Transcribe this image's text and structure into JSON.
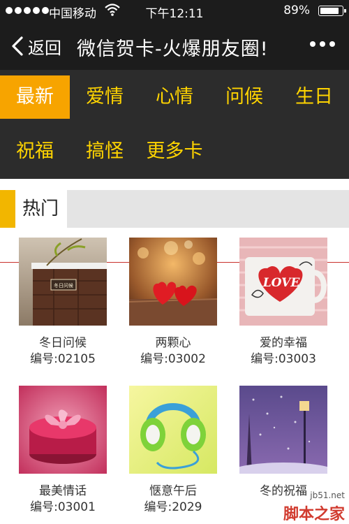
{
  "status_bar": {
    "carrier": "中国移动",
    "time": "下午12:11",
    "battery_percent": "89%",
    "battery_level": 0.89
  },
  "nav": {
    "back_label": "返回",
    "title": "微信贺卡-火爆朋友圈!"
  },
  "categories": [
    {
      "label": "最新",
      "active": true
    },
    {
      "label": "爱情",
      "active": false
    },
    {
      "label": "心情",
      "active": false
    },
    {
      "label": "问候",
      "active": false
    },
    {
      "label": "生日",
      "active": false
    },
    {
      "label": "祝福",
      "active": false
    },
    {
      "label": "搞怪",
      "active": false
    },
    {
      "label": "更多卡",
      "active": false
    }
  ],
  "section": {
    "title": "热门"
  },
  "cards": [
    {
      "name": "冬日问候",
      "code_label": "编号:",
      "code": "02105"
    },
    {
      "name": "两颗心",
      "code_label": "编号:",
      "code": "03002"
    },
    {
      "name": "爱的幸福",
      "code_label": "编号:",
      "code": "03003"
    },
    {
      "name": "最美情话",
      "code_label": "编号:",
      "code": "03001"
    },
    {
      "name": "惬意午后",
      "code_label": "编号:",
      "code": "2029"
    },
    {
      "name": "冬的祝福",
      "code_label": "",
      "code": ""
    }
  ],
  "card_images": {
    "love_mug_text": "LOVE",
    "winter_sign_text": "冬日问候"
  },
  "watermark": {
    "site": "jb51.net",
    "brand": "脚本之家"
  },
  "icons": [
    "signal-dots-icon",
    "wifi-icon",
    "battery-icon",
    "back-chevron-icon",
    "more-dots-icon"
  ],
  "colors": {
    "bar_bg": "#1c1c1c",
    "menu_bg": "#2c2c2c",
    "menu_text": "#ffd400",
    "active_tab": "#f7a400",
    "section_accent": "#f2b600"
  }
}
